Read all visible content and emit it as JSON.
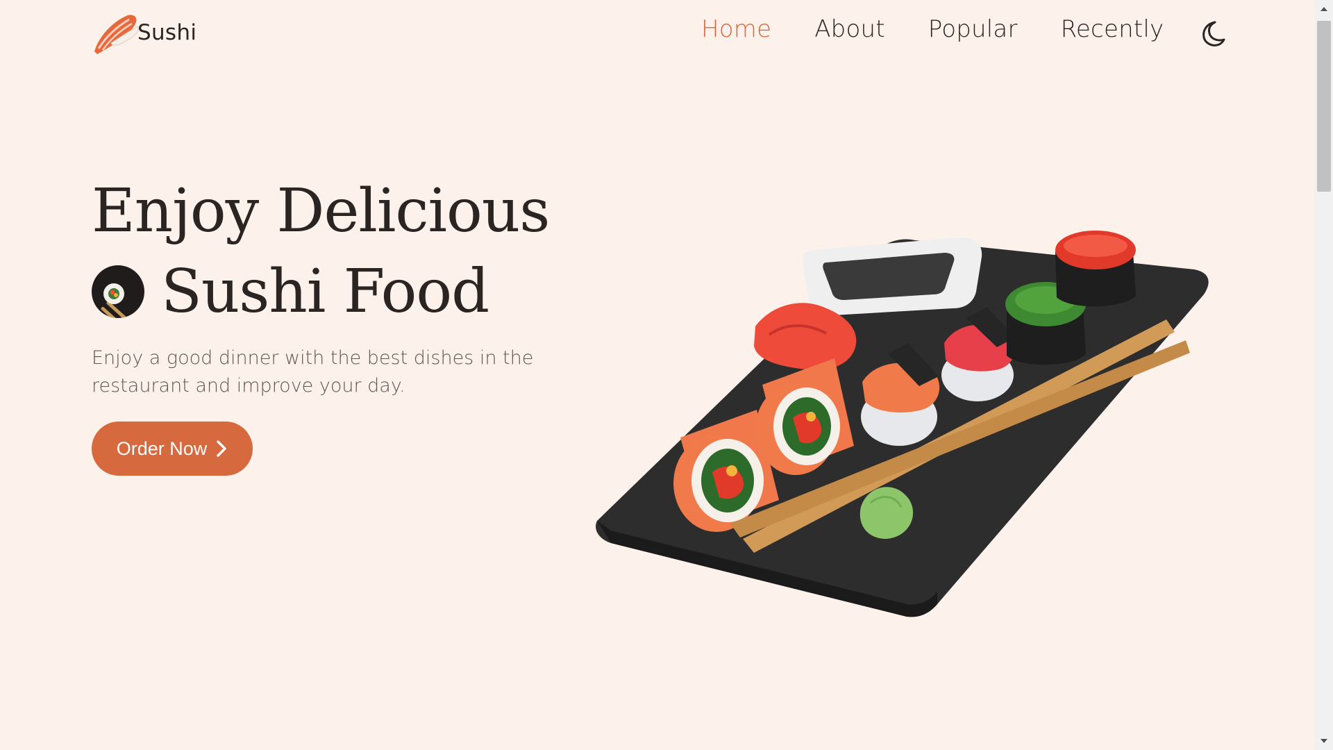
{
  "brand": {
    "name": "Sushi",
    "accent": "#d9663a"
  },
  "nav": {
    "items": [
      {
        "label": "Home",
        "active": true
      },
      {
        "label": "About",
        "active": false
      },
      {
        "label": "Popular",
        "active": false
      },
      {
        "label": "Recently",
        "active": false
      }
    ],
    "theme_icon": "moon-icon"
  },
  "hero": {
    "title_line1": "Enjoy Delicious",
    "title_line2": "Sushi Food",
    "description": "Enjoy a good dinner with the best dishes in the restaurant and improve your day.",
    "cta_label": "Order Now",
    "cta_icon": "chevron-right-icon",
    "image": "sushi-platter-image"
  },
  "colors": {
    "background": "#fdf1ec",
    "button": "#d7693e",
    "text": "#2a2523"
  }
}
